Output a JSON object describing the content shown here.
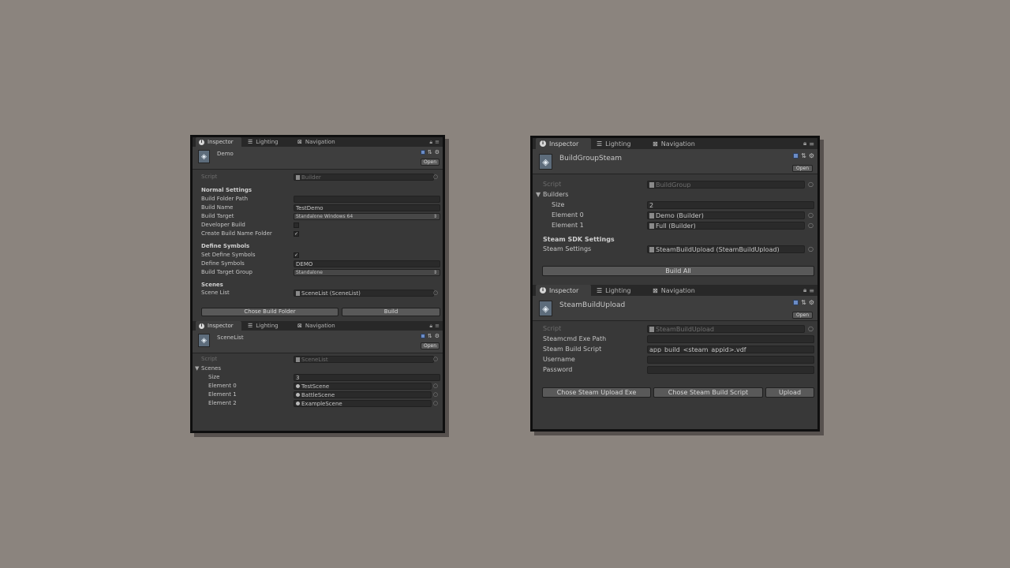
{
  "tabs": {
    "inspector": "Inspector",
    "lighting": "Lighting",
    "navigation": "Navigation"
  },
  "header": {
    "open_label": "Open"
  },
  "demo": {
    "object_name": "Demo",
    "script_label": "Script",
    "script_value": "Builder",
    "normal_settings_title": "Normal Settings",
    "build_folder_path_label": "Build Folder Path",
    "build_folder_path_value": "",
    "build_name_label": "Build Name",
    "build_name_value": "TestDemo",
    "build_target_label": "Build Target",
    "build_target_value": "Standalone Windows 64",
    "developer_build_label": "Developer Build",
    "developer_build_checked": false,
    "create_folder_label": "Create Build Name Folder",
    "create_folder_checked": true,
    "define_symbols_title": "Define Symbols",
    "set_define_symbols_label": "Set Define Symbols",
    "set_define_symbols_checked": true,
    "define_symbols_label": "Define Symbols",
    "define_symbols_value": "DEMO",
    "build_target_group_label": "Build Target Group",
    "build_target_group_value": "Standalone",
    "scenes_title": "Scenes",
    "scene_list_label": "Scene List",
    "scene_list_value": "SceneList (SceneList)",
    "chose_build_folder_label": "Chose Build Folder",
    "build_label": "Build"
  },
  "scenelist": {
    "object_name": "SceneList",
    "script_label": "Script",
    "script_value": "SceneList",
    "scenes_label": "Scenes",
    "size_label": "Size",
    "size_value": "3",
    "elements": [
      {
        "label": "Element 0",
        "value": "TestScene"
      },
      {
        "label": "Element 1",
        "value": "BattleScene"
      },
      {
        "label": "Element 2",
        "value": "ExampleScene"
      }
    ]
  },
  "buildgroup": {
    "object_name": "BuildGroupSteam",
    "script_label": "Script",
    "script_value": "BuildGroup",
    "builders_label": "Builders",
    "size_label": "Size",
    "size_value": "2",
    "elements": [
      {
        "label": "Element 0",
        "value": "Demo (Builder)"
      },
      {
        "label": "Element 1",
        "value": "Full (Builder)"
      }
    ],
    "steam_sdk_title": "Steam SDK Settings",
    "steam_settings_label": "Steam Settings",
    "steam_settings_value": "SteamBuildUpload (SteamBuildUpload)",
    "build_all_label": "Build All"
  },
  "steamupload": {
    "object_name": "SteamBuildUpload",
    "script_label": "Script",
    "script_value": "SteamBuildUpload",
    "steamcmd_label": "Steamcmd Exe Path",
    "steamcmd_value": "",
    "build_script_label": "Steam Build Script",
    "build_script_value": "app_build_<steam_appid>.vdf",
    "username_label": "Username",
    "username_value": "",
    "password_label": "Password",
    "password_value": "",
    "chose_exe_label": "Chose Steam Upload Exe",
    "chose_script_label": "Chose Steam Build Script",
    "upload_label": "Upload"
  }
}
